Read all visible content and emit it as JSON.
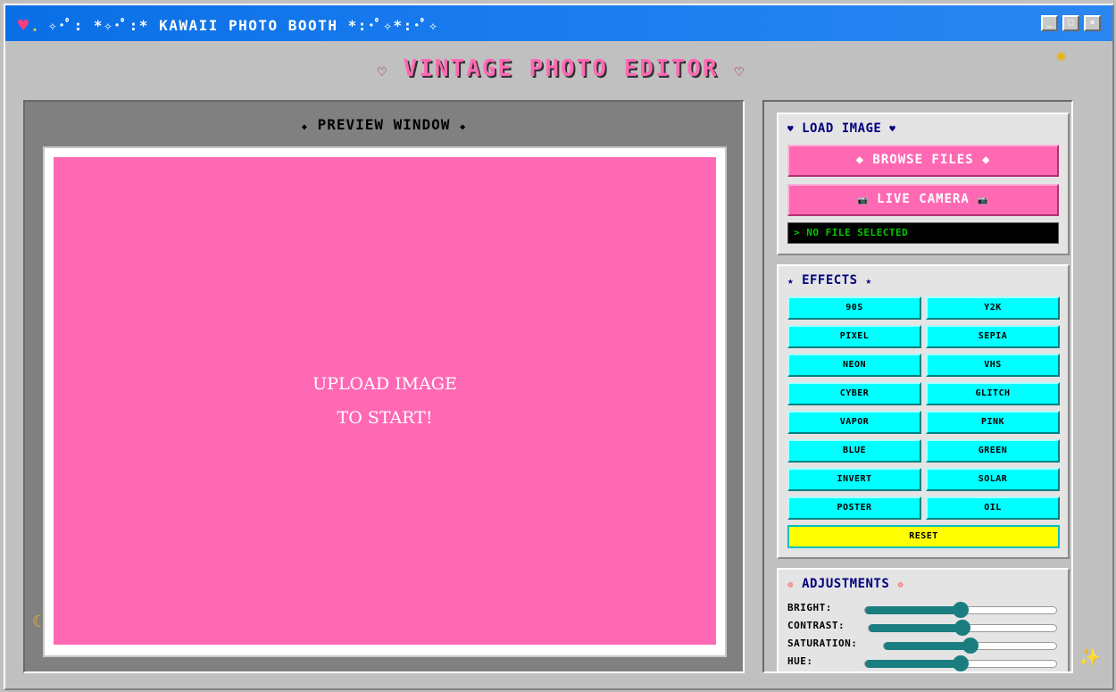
{
  "window": {
    "title": "✧･ﾟ: *✧･ﾟ:* KAWAII PHOTO BOOTH *:･ﾟ✧*:･ﾟ✧",
    "controls": {
      "minimize": "_",
      "maximize": "□",
      "close": "×"
    }
  },
  "header": {
    "title": "VINTAGE PHOTO EDITOR",
    "deco": "♡"
  },
  "preview": {
    "title": "PREVIEW WINDOW",
    "deco": "◆",
    "placeholder_line1": "UPLOAD IMAGE",
    "placeholder_line2": "TO START!"
  },
  "load_image": {
    "title": "LOAD IMAGE",
    "deco": "♥",
    "browse_label": "◆ BROWSE FILES ◆",
    "camera_label": "LIVE CAMERA",
    "camera_icon": "📷",
    "status": "> NO FILE SELECTED"
  },
  "effects": {
    "title": "EFFECTS",
    "deco": "★",
    "buttons": [
      "90S",
      "Y2K",
      "PIXEL",
      "SEPIA",
      "NEON",
      "VHS",
      "CYBER",
      "GLITCH",
      "VAPOR",
      "PINK",
      "BLUE",
      "GREEN",
      "INVERT",
      "SOLAR",
      "POSTER",
      "OIL"
    ],
    "reset_label": "RESET"
  },
  "adjustments": {
    "title": "ADJUSTMENTS",
    "deco": "❁",
    "sliders": [
      {
        "label": "BRIGHT:",
        "value": 0.5
      },
      {
        "label": "CONTRAST:",
        "value": 0.5
      },
      {
        "label": "SATURATION:",
        "value": 0.5
      },
      {
        "label": "HUE:",
        "value": 0.5
      }
    ]
  },
  "colors": {
    "titlebar": "#0a6fe6",
    "pink": "#ff69b4",
    "cyan": "#00ffff",
    "yellow": "#ffff00",
    "navy": "#000080",
    "teal": "#1a7e80"
  },
  "icons": {
    "title": "heart-sparkle-icon",
    "corner_top": "sun-icon",
    "corner_bottom_left": "moon-icon",
    "corner_bottom_right": "sparkle-icon"
  }
}
